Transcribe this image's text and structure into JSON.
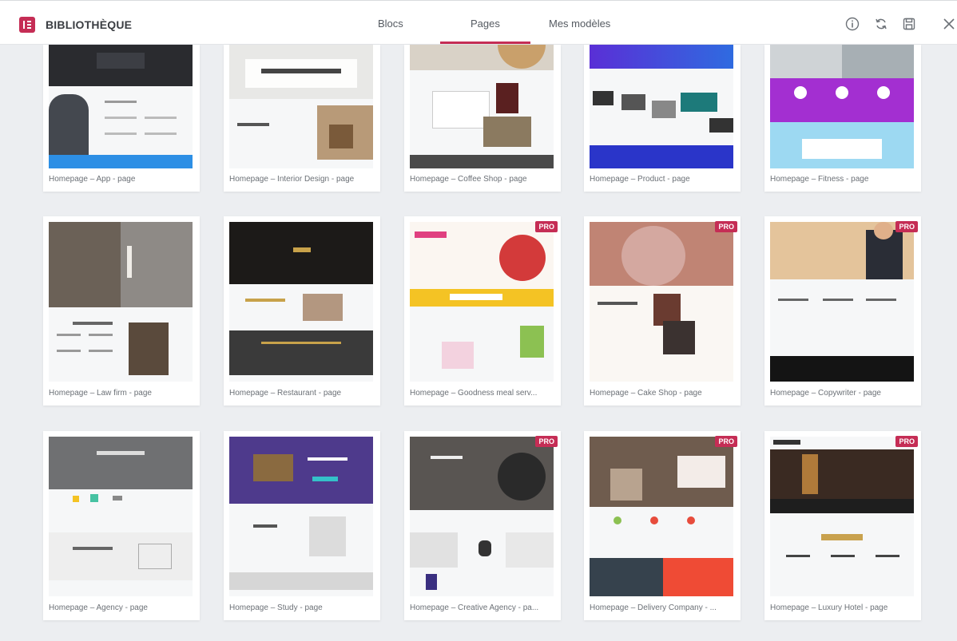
{
  "header": {
    "title": "BIBLIOTHÈQUE",
    "tabs": [
      {
        "label": "Blocs",
        "active": false
      },
      {
        "label": "Pages",
        "active": true
      },
      {
        "label": "Mes modèles",
        "active": false
      }
    ],
    "icons": [
      "info-icon",
      "sync-icon",
      "save-icon",
      "close-icon"
    ]
  },
  "colors": {
    "accent": "#c52d55",
    "background": "#eceef1"
  },
  "pro_label": "PRO",
  "templates": [
    {
      "label": "Homepage – App - page",
      "pro": false
    },
    {
      "label": "Homepage – Interior Design - page",
      "pro": false
    },
    {
      "label": "Homepage – Coffee Shop - page",
      "pro": false
    },
    {
      "label": "Homepage – Product - page",
      "pro": false
    },
    {
      "label": "Homepage – Fitness - page",
      "pro": false
    },
    {
      "label": "Homepage – Law firm - page",
      "pro": false
    },
    {
      "label": "Homepage – Restaurant - page",
      "pro": false
    },
    {
      "label": "Homepage – Goodness meal serv...",
      "pro": true
    },
    {
      "label": "Homepage – Cake Shop - page",
      "pro": true
    },
    {
      "label": "Homepage – Copywriter - page",
      "pro": true
    },
    {
      "label": "Homepage – Agency - page",
      "pro": false
    },
    {
      "label": "Homepage – Study - page",
      "pro": false
    },
    {
      "label": "Homepage – Creative Agency - pa...",
      "pro": true
    },
    {
      "label": "Homepage – Delivery Company - ...",
      "pro": true
    },
    {
      "label": "Homepage – Luxury Hotel - page",
      "pro": true
    }
  ]
}
